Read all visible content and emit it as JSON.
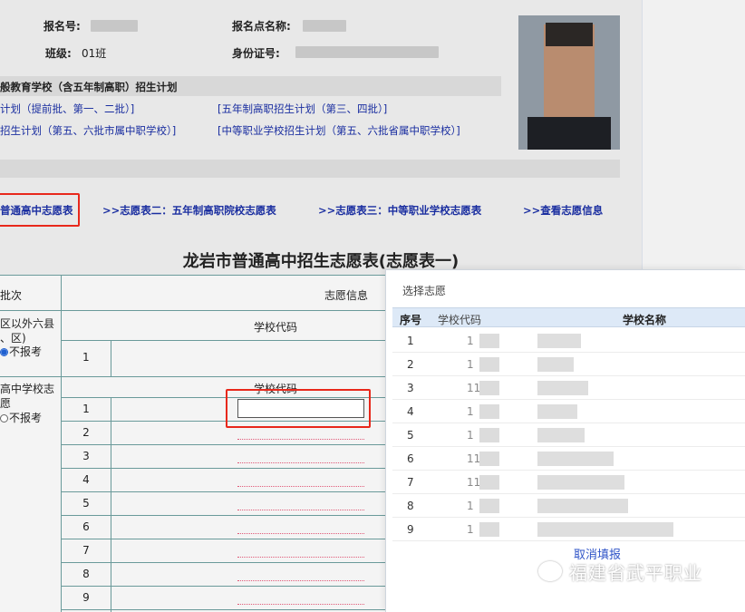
{
  "header": {
    "reg_no_label": "报名号:",
    "site_label": "报名点名称:",
    "class_label": "班级:",
    "class_value": "01班",
    "id_label": "身份证号:"
  },
  "plans": {
    "section_title": "般教育学校（含五年制高职）招生计划",
    "link1": "计划（提前批、第一、二批）]",
    "link2": "[五年制高职招生计划（第三、四批）]",
    "link3": "招生计划（第五、六批市属中职学校）]",
    "link4": "[中等职业学校招生计划（第五、六批省属中职学校）]"
  },
  "nav": {
    "tab1": "普通高中志愿表",
    "tab2": ">>志愿表二：五年制高职院校志愿表",
    "tab3": ">>志愿表三：中等职业学校志愿表",
    "tab4": ">>查看志愿信息"
  },
  "form": {
    "title": "龙岩市普通高中招生志愿表(志愿表一)",
    "col_batch": "批次",
    "col_info": "志愿信息",
    "group1_label_1": "区以外六县",
    "group1_label_2": "、区)",
    "group1_option": "不报考",
    "school_code_label": "学校代码",
    "school_code_label_2": "学校代码",
    "group2_label_1": "高中学校志",
    "group2_label_2": "愿",
    "group2_option": "不报考",
    "g1_row": "1",
    "rows": [
      "1",
      "2",
      "3",
      "4",
      "5",
      "6",
      "7",
      "8",
      "9"
    ]
  },
  "modal": {
    "title": "选择志愿",
    "col_index": "序号",
    "col_code": "学校代码",
    "col_name": "学校名称",
    "rows": [
      {
        "idx": "1",
        "code": "1"
      },
      {
        "idx": "2",
        "code": "1"
      },
      {
        "idx": "3",
        "code": "11"
      },
      {
        "idx": "4",
        "code": "1"
      },
      {
        "idx": "5",
        "code": "1"
      },
      {
        "idx": "6",
        "code": "11"
      },
      {
        "idx": "7",
        "code": "11"
      },
      {
        "idx": "8",
        "code": "1"
      },
      {
        "idx": "9",
        "code": "1"
      }
    ],
    "cancel_label": "取消填报"
  },
  "watermark": {
    "text": "福建省武平职业"
  }
}
